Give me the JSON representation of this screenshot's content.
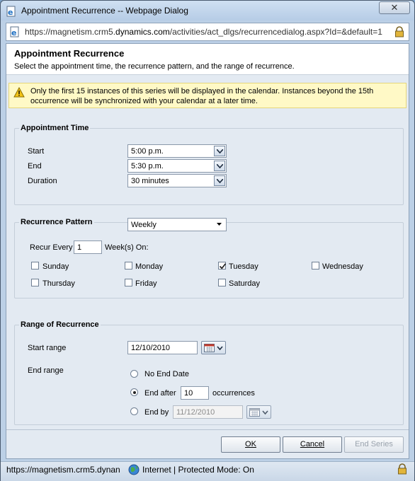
{
  "window": {
    "title": "Appointment Recurrence -- Webpage Dialog",
    "close_label": "✕"
  },
  "address": {
    "prefix": "https://magnetism.crm5.",
    "domain": "dynamics.com",
    "path": "/activities/act_dlgs/recurrencedialog.aspx?Id=&default=1"
  },
  "dialog": {
    "title": "Appointment Recurrence",
    "description": "Select the appointment time, the recurrence pattern, and the range of recurrence.",
    "notice": "Only the first 15 instances of this series will be displayed in the calendar. Instances beyond the 15th occurrence will be synchronized with your calendar at a later time."
  },
  "appointment_time": {
    "title": "Appointment Time",
    "start_label": "Start",
    "start_value": "5:00 p.m.",
    "end_label": "End",
    "end_value": "5:30 p.m.",
    "duration_label": "Duration",
    "duration_value": "30 minutes"
  },
  "recurrence_pattern": {
    "title": "Recurrence Pattern",
    "pattern_value": "Weekly",
    "recur_every_label": "Recur Every",
    "recur_every_value": "1",
    "weeks_on_label": "Week(s) On:",
    "days": [
      {
        "label": "Sunday",
        "checked": false
      },
      {
        "label": "Monday",
        "checked": false
      },
      {
        "label": "Tuesday",
        "checked": true
      },
      {
        "label": "Wednesday",
        "checked": false
      },
      {
        "label": "Thursday",
        "checked": false
      },
      {
        "label": "Friday",
        "checked": false
      },
      {
        "label": "Saturday",
        "checked": false
      }
    ]
  },
  "range": {
    "title": "Range of Recurrence",
    "start_range_label": "Start range",
    "start_range_value": "12/10/2010",
    "end_range_label": "End range",
    "no_end_label": "No End Date",
    "end_after_label": "End after",
    "end_after_value": "10",
    "occurrences_label": "occurrences",
    "end_by_label": "End by",
    "end_by_value": "11/12/2010",
    "selected": "end_after"
  },
  "buttons": {
    "ok": "OK",
    "cancel": "Cancel",
    "end_series": "End Series"
  },
  "status": {
    "url": "https://magnetism.crm5.dynan",
    "zone": "Internet | Protected Mode: On"
  },
  "colors": {
    "frame": "#bcd0e6",
    "panel": "#e3eaf2",
    "notice_bg": "#fff9c6"
  }
}
